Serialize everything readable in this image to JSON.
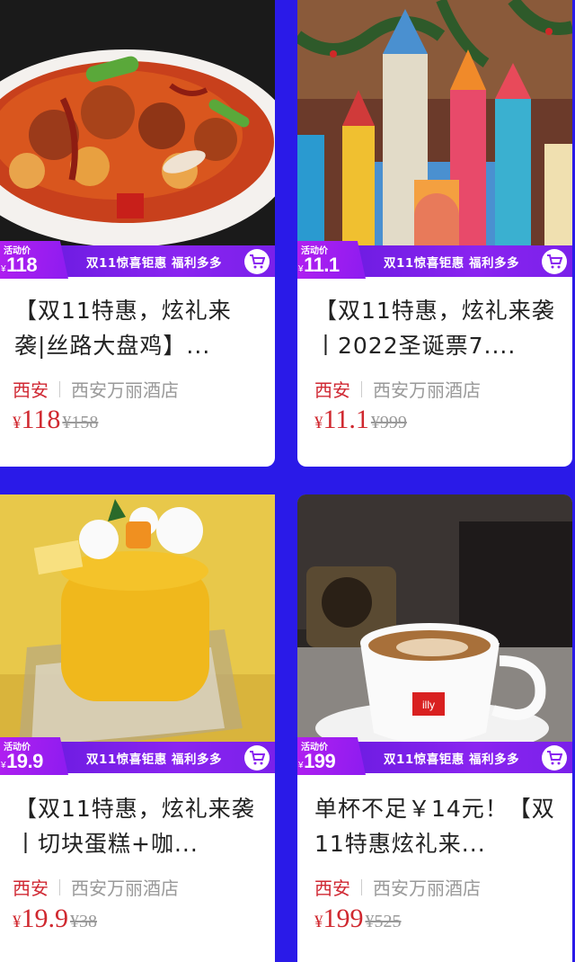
{
  "banner": {
    "badge_label": "活动价",
    "yen": "¥",
    "promo_text": "双11惊喜钜惠 福利多多"
  },
  "products": [
    {
      "badge_price": "118",
      "title": "【双11特惠，炫礼来袭|丝路大盘鸡】...",
      "city": "西安",
      "store": "西安万丽酒店",
      "price_symbol": "¥",
      "price": "118",
      "original_price": "¥158",
      "image": "spicy-chicken-dish-photo"
    },
    {
      "badge_price": "11.1",
      "title": "【双11特惠，炫礼来袭丨2022圣诞票7....",
      "city": "西安",
      "store": "西安万丽酒店",
      "price_symbol": "¥",
      "price": "11.1",
      "original_price": "¥999",
      "image": "christmas-castle-photo"
    },
    {
      "badge_price": "19.9",
      "title": "【双11特惠，炫礼来袭丨切块蛋糕+咖...",
      "city": "西安",
      "store": "西安万丽酒店",
      "price_symbol": "¥",
      "price": "19.9",
      "original_price": "¥38",
      "image": "mango-cake-photo"
    },
    {
      "badge_price": "199",
      "title": "单杯不足￥14元！【双11特惠炫礼来...",
      "city": "西安",
      "store": "西安万丽酒店",
      "price_symbol": "¥",
      "price": "199",
      "original_price": "¥525",
      "image": "coffee-cup-photo"
    }
  ],
  "colors": {
    "background": "#2a1ae8",
    "promo_purple": "#8a24f0",
    "price_red": "#d0282f"
  }
}
